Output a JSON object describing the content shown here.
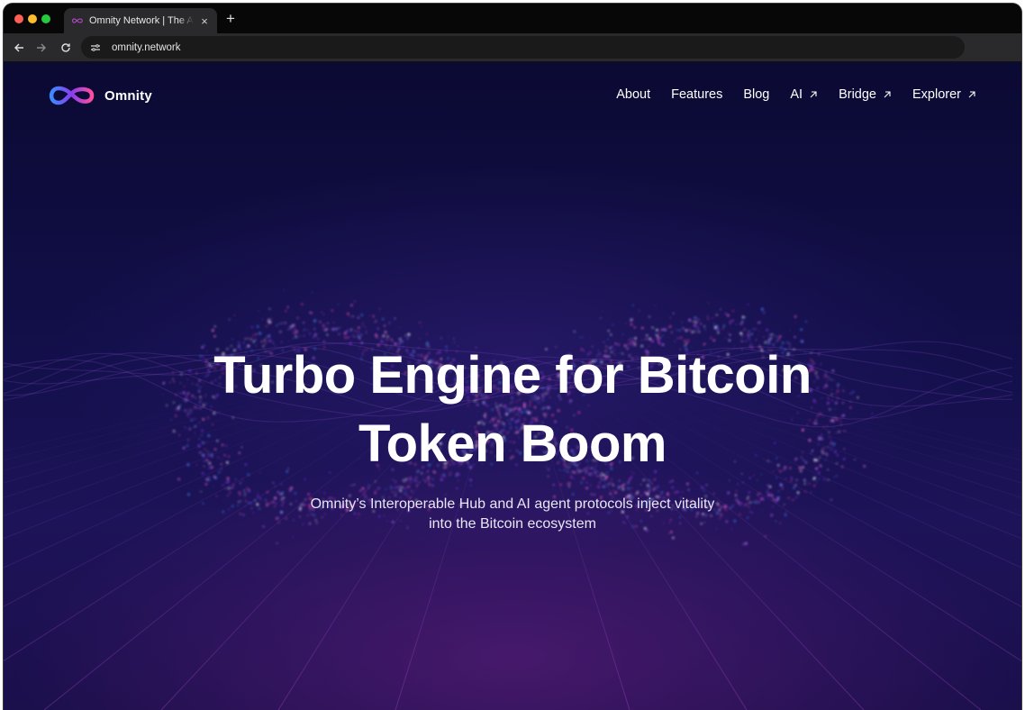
{
  "browser": {
    "tab_title": "Omnity Network | The Asset Hub",
    "tab_close": "×",
    "new_tab": "+",
    "url": "omnity.network"
  },
  "site": {
    "logo_text": "Omnity",
    "nav": [
      {
        "label": "About",
        "external": false
      },
      {
        "label": "Features",
        "external": false
      },
      {
        "label": "Blog",
        "external": false
      },
      {
        "label": "AI",
        "external": true
      },
      {
        "label": "Bridge",
        "external": true
      },
      {
        "label": "Explorer",
        "external": true
      }
    ]
  },
  "hero": {
    "title_line1": "Turbo Engine for Bitcoin",
    "title_line2": "Token Boom",
    "subtitle_line1": "Omnity’s Interoperable Hub and AI agent protocols  inject vitality",
    "subtitle_line2": "into the Bitcoin ecosystem"
  },
  "colors": {
    "page_bg": "#120f4a",
    "accent_pink": "#e23fa8",
    "accent_blue": "#3c8cff",
    "accent_purple": "#8a3cf0"
  }
}
